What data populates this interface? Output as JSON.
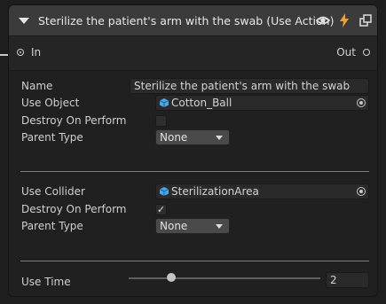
{
  "header": {
    "title": "Sterilize the patient's arm with the swab (Use Action)"
  },
  "ports": {
    "in_label": "In",
    "out_label": "Out"
  },
  "fields": {
    "name_label": "Name",
    "name_value": "Sterilize the patient's arm with the swab",
    "use_object_label": "Use Object",
    "use_object_value": "Cotton_Ball",
    "destroy1_label": "Destroy On Perform",
    "destroy1_checked": false,
    "parent_type1_label": "Parent Type",
    "parent_type1_value": "None",
    "use_collider_label": "Use Collider",
    "use_collider_value": "SterilizationArea",
    "destroy2_label": "Destroy On Perform",
    "destroy2_checked": true,
    "destroy2_mark": "✓",
    "parent_type2_label": "Parent Type",
    "parent_type2_value": "None",
    "use_time_label": "Use Time",
    "use_time_value": "2",
    "use_time_slider_fraction": 0.22
  },
  "colors": {
    "accent_lightning": "#f0a030",
    "header_bg": "#3b3b3b",
    "body_bg": "#202020"
  }
}
